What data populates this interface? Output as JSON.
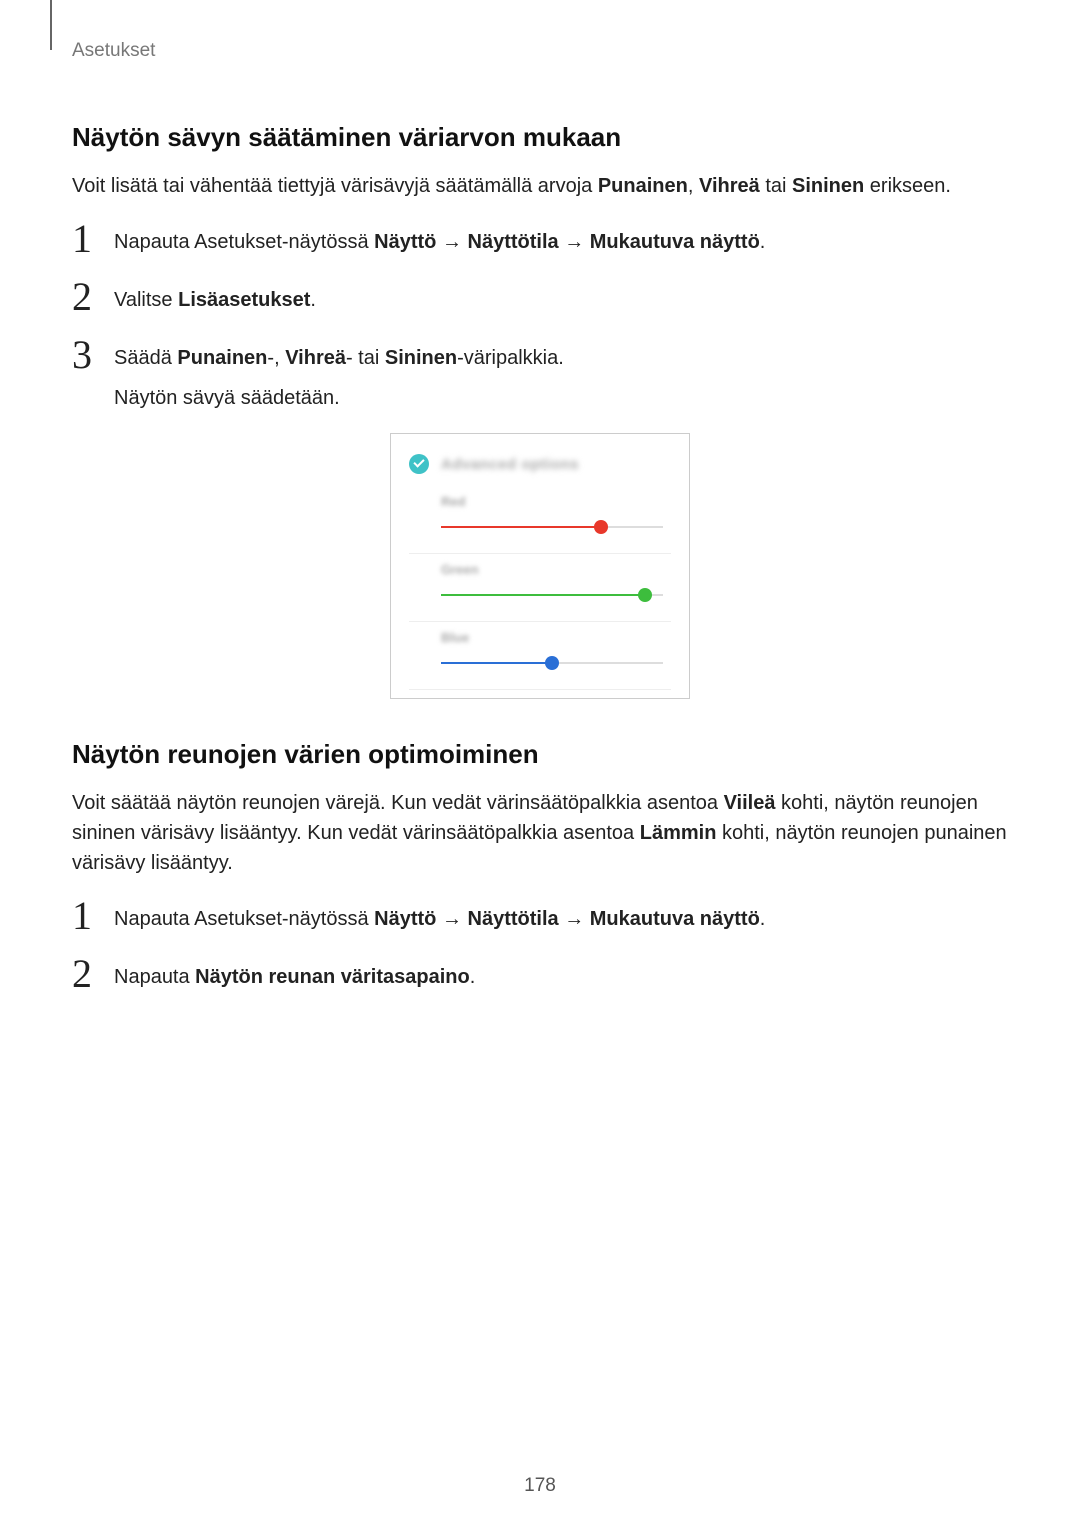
{
  "breadcrumb": "Asetukset",
  "page_number": "178",
  "section1": {
    "heading": "Näytön sävyn säätäminen väriarvon mukaan",
    "intro_pre": "Voit lisätä tai vähentää tiettyjä värisävyjä säätämällä arvoja ",
    "intro_b1": "Punainen",
    "intro_sep1": ", ",
    "intro_b2": "Vihreä",
    "intro_sep2": " tai ",
    "intro_b3": "Sininen",
    "intro_post": " erikseen.",
    "step1": {
      "num": "1",
      "pre": "Napauta Asetukset-näytössä ",
      "b1": "Näyttö",
      "sep1": " → ",
      "b2": "Näyttötila",
      "sep2": " → ",
      "b3": "Mukautuva näyttö",
      "post": "."
    },
    "step2": {
      "num": "2",
      "pre": "Valitse ",
      "b1": "Lisäasetukset",
      "post": "."
    },
    "step3": {
      "num": "3",
      "pre": "Säädä ",
      "b1": "Punainen",
      "sep1": "-, ",
      "b2": "Vihreä",
      "sep2": "- tai ",
      "b3": "Sininen",
      "post": "-väripalkkia.",
      "note": "Näytön sävyä säädetään."
    }
  },
  "device": {
    "advanced_label": "Advanced options",
    "sliders": {
      "red": {
        "label": "Red",
        "value": 72
      },
      "green": {
        "label": "Green",
        "value": 92
      },
      "blue": {
        "label": "Blue",
        "value": 50
      }
    }
  },
  "section2": {
    "heading": "Näytön reunojen värien optimoiminen",
    "intro_pre": "Voit säätää näytön reunojen värejä. Kun vedät värinsäätöpalkkia asentoa ",
    "intro_b1": "Viileä",
    "intro_mid": " kohti, näytön reunojen sininen värisävy lisääntyy. Kun vedät värinsäätöpalkkia asentoa ",
    "intro_b2": "Lämmin",
    "intro_post": " kohti, näytön reunojen punainen värisävy lisääntyy.",
    "step1": {
      "num": "1",
      "pre": "Napauta Asetukset-näytössä ",
      "b1": "Näyttö",
      "sep1": " → ",
      "b2": "Näyttötila",
      "sep2": " → ",
      "b3": "Mukautuva näyttö",
      "post": "."
    },
    "step2": {
      "num": "2",
      "pre": "Napauta ",
      "b1": "Näytön reunan väritasapaino",
      "post": "."
    }
  }
}
